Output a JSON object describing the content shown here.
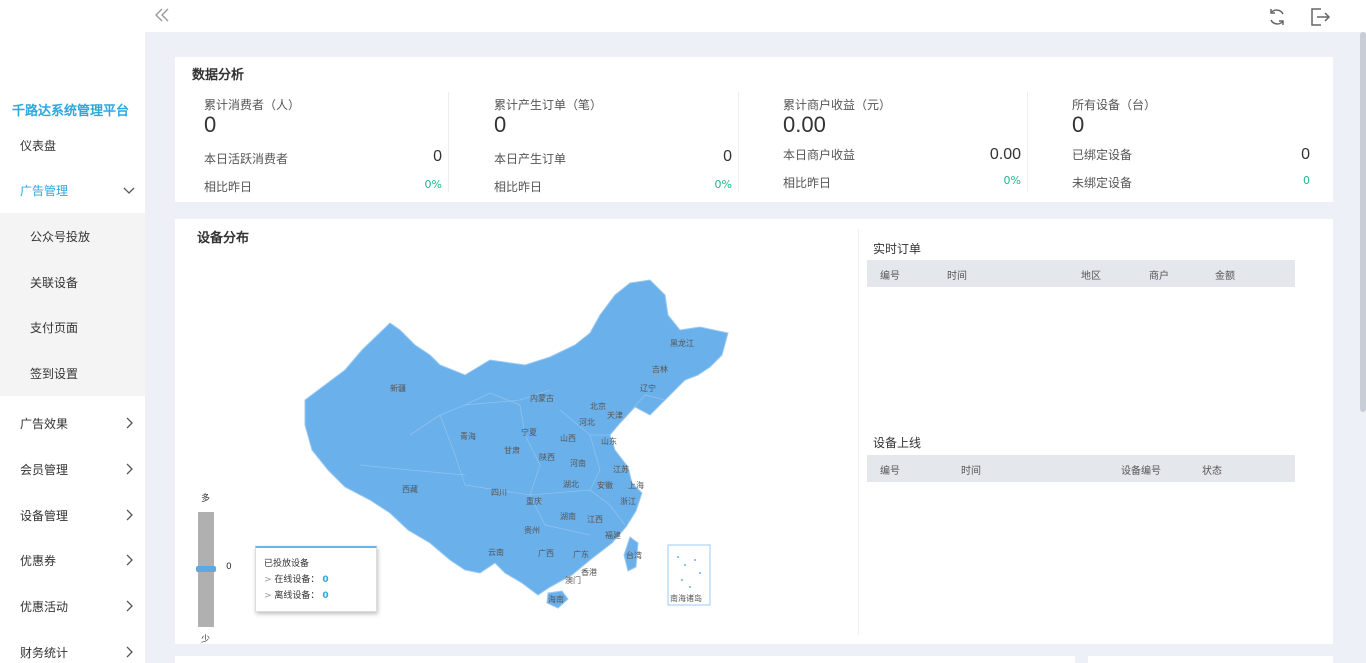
{
  "sidebar": {
    "brand": "千路达系统管理平台",
    "items": [
      {
        "label": "仪表盘"
      },
      {
        "label": "广告管理"
      },
      {
        "label": "广告效果"
      },
      {
        "label": "会员管理"
      },
      {
        "label": "设备管理"
      },
      {
        "label": "优惠券"
      },
      {
        "label": "优惠活动"
      },
      {
        "label": "财务统计"
      }
    ],
    "submenu": [
      {
        "label": "公众号投放"
      },
      {
        "label": "关联设备"
      },
      {
        "label": "支付页面"
      },
      {
        "label": "签到设置"
      }
    ]
  },
  "topbar": {
    "icons": [
      "collapse-icon",
      "refresh-icon",
      "logout-icon"
    ]
  },
  "analysis": {
    "title": "数据分析",
    "cols": [
      {
        "label": "累计消费者（人）",
        "value": "0",
        "row1_label": "本日活跃消费者",
        "row1_value": "0",
        "row2_label": "相比昨日",
        "row2_value": "0%"
      },
      {
        "label": "累计产生订单（笔）",
        "value": "0",
        "row1_label": "本日产生订单",
        "row1_value": "0",
        "row2_label": "相比昨日",
        "row2_value": "0%"
      },
      {
        "label": "累计商户收益（元）",
        "value": "0.00",
        "row1_label": "本日商户收益",
        "row1_value": "0.00",
        "row2_label": "相比昨日",
        "row2_value": "0%"
      },
      {
        "label": "所有设备（台）",
        "value": "0",
        "row1_label": "已绑定设备",
        "row1_value": "0",
        "row2_label": "未绑定设备",
        "row2_value": "0"
      }
    ]
  },
  "distribution": {
    "title": "设备分布",
    "slider_top": "多",
    "slider_bottom": "少",
    "slider_value": "0",
    "tooltip": {
      "title": "已投放设备",
      "online_label": "在线设备：",
      "online_value": "0",
      "offline_label": "离线设备：",
      "offline_value": "0"
    },
    "provinces": [
      "新疆",
      "西藏",
      "青海",
      "甘肃",
      "内蒙古",
      "宁夏",
      "陕西",
      "山西",
      "河北",
      "北京",
      "天津",
      "辽宁",
      "吉林",
      "黑龙江",
      "山东",
      "河南",
      "江苏",
      "上海",
      "安徽",
      "湖北",
      "四川",
      "重庆",
      "贵州",
      "湖南",
      "江西",
      "浙江",
      "福建",
      "云南",
      "广西",
      "广东",
      "香港",
      "澳门",
      "台湾",
      "海南"
    ],
    "islands_label": "南海诸岛"
  },
  "realtime": {
    "title": "实时订单",
    "columns": [
      "编号",
      "时间",
      "地区",
      "商户",
      "金额"
    ]
  },
  "online": {
    "title": "设备上线",
    "columns": [
      "编号",
      "时间",
      "设备编号",
      "状态"
    ]
  }
}
